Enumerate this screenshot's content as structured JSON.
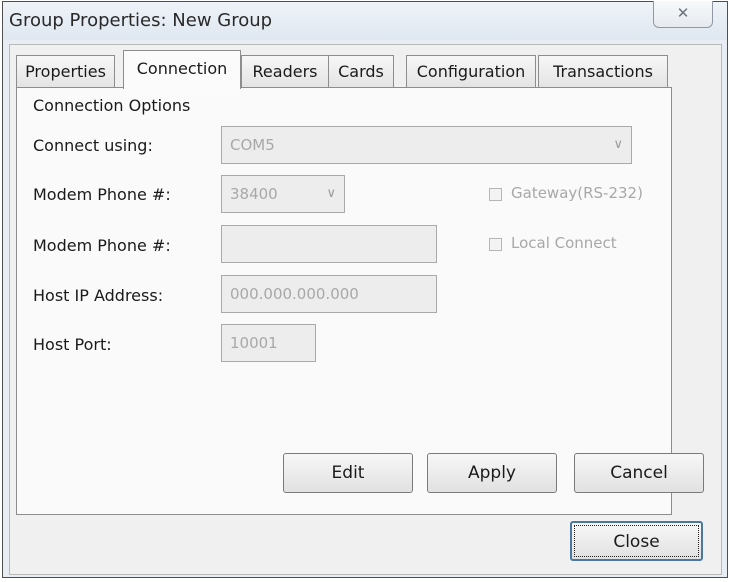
{
  "window": {
    "title": "Group Properties: New Group",
    "close_glyph": "✕"
  },
  "tabs": [
    {
      "label": "Properties"
    },
    {
      "label": "Connection"
    },
    {
      "label": "Readers"
    },
    {
      "label": "Cards"
    },
    {
      "label": "Configuration"
    },
    {
      "label": "Transactions"
    }
  ],
  "connection": {
    "section_title": "Connection Options",
    "connect_using_label": "Connect using:",
    "connect_using_value": "COM5",
    "modem_speed_label": "Modem Phone #:",
    "modem_speed_value": "38400",
    "modem_phone_label": "Modem Phone #:",
    "modem_phone_value": "",
    "host_ip_label": "Host IP Address:",
    "host_ip_value": "000.000.000.000",
    "host_port_label": "Host Port:",
    "host_port_value": "10001",
    "gateway_label": "Gateway(RS-232)",
    "local_connect_label": "Local Connect",
    "dropdown_arrow": "∨"
  },
  "buttons": {
    "edit": "Edit",
    "apply": "Apply",
    "cancel": "Cancel",
    "close": "Close"
  }
}
